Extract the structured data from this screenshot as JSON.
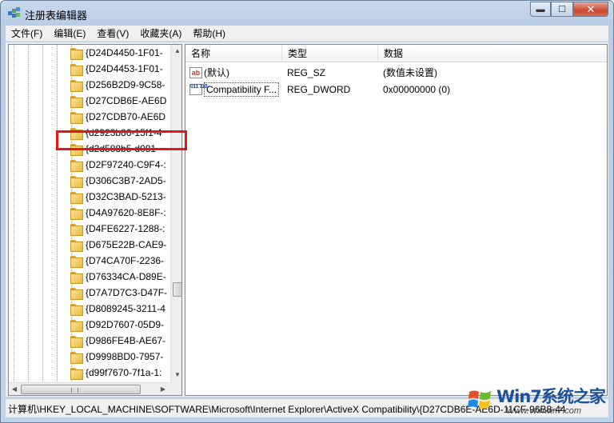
{
  "window": {
    "title": "注册表编辑器",
    "min_glyph": "▬",
    "max_glyph": "☐",
    "close_glyph": "✕"
  },
  "menu": [
    "文件(F)",
    "编辑(E)",
    "查看(V)",
    "收藏夹(A)",
    "帮助(H)"
  ],
  "tree": {
    "items": [
      "{D24D4450-1F01-",
      "{D24D4453-1F01-",
      "{D256B2D9-9C58-",
      "{D27CDB6E-AE6D",
      "{D27CDB70-AE6D",
      "{d2923b86-15f1-4",
      "{d2d588b5-d081-",
      "{D2F97240-C9F4-:",
      "{D306C3B7-2AD5-",
      "{D32C3BAD-5213-",
      "{D4A97620-8E8F-:",
      "{D4FE6227-1288-:",
      "{D675E22B-CAE9-",
      "{D74CA70F-2236-",
      "{D76334CA-D89E-",
      "{D7A7D7C3-D47F-",
      "{D8089245-3211-4",
      "{D92D7607-05D9-",
      "{D986FE4B-AE67-",
      "{D9998BD0-7957-",
      "{d99f7670-7f1a-1:"
    ],
    "selected_index": 3,
    "scroll_up_glyph": "▲",
    "scroll_down_glyph": "▼",
    "scroll_left_glyph": "◀",
    "scroll_right_glyph": "▶"
  },
  "list": {
    "columns": {
      "name": "名称",
      "type": "类型",
      "data": "数据"
    },
    "rows": [
      {
        "icon": "string-value-icon",
        "icon_text": "ab",
        "name": "(默认)",
        "type": "REG_SZ",
        "data": "(数值未设置)"
      },
      {
        "icon": "binary-value-icon",
        "icon_text": "011 110",
        "name": "Compatibility F...",
        "type": "REG_DWORD",
        "data": "0x00000000 (0)"
      }
    ]
  },
  "status": {
    "path": "计算机\\HKEY_LOCAL_MACHINE\\SOFTWARE\\Microsoft\\Internet Explorer\\ActiveX Compatibility\\{D27CDB6E-AE6D-11CF-96B8-44"
  },
  "watermark": {
    "brand": "Win7系统之家",
    "url": "Www.Winwin7.com"
  },
  "colors": {
    "highlight": "#e01818",
    "title_bg": "#c2d4ea",
    "brand": "#1c4f9c"
  }
}
